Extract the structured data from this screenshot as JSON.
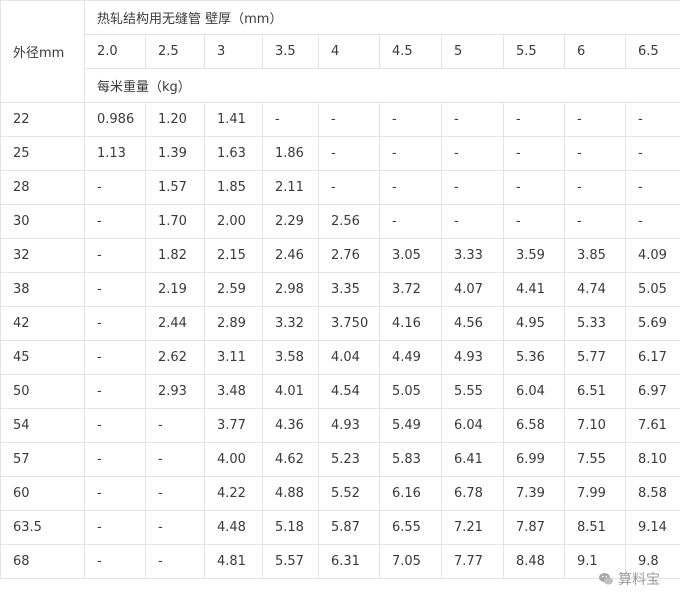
{
  "table": {
    "od_label": "外径mm",
    "title": "热轧结构用无缝管 壁厚（mm）",
    "unit_row": "每米重量（kg）",
    "thicknesses": [
      "2.0",
      "2.5",
      "3",
      "3.5",
      "4",
      "4.5",
      "5",
      "5.5",
      "6",
      "6.5"
    ],
    "rows": [
      {
        "od": "22",
        "values": [
          "0.986",
          "1.20",
          "1.41",
          "-",
          "-",
          "-",
          "-",
          "-",
          "-",
          "-"
        ]
      },
      {
        "od": "25",
        "values": [
          "1.13",
          "1.39",
          "1.63",
          "1.86",
          "-",
          "-",
          "-",
          "-",
          "-",
          "-"
        ]
      },
      {
        "od": "28",
        "values": [
          "-",
          "1.57",
          "1.85",
          "2.11",
          "-",
          "-",
          "-",
          "-",
          "-",
          "-"
        ]
      },
      {
        "od": "30",
        "values": [
          "-",
          "1.70",
          "2.00",
          "2.29",
          "2.56",
          "-",
          "-",
          "-",
          "-",
          "-"
        ]
      },
      {
        "od": "32",
        "values": [
          "-",
          "1.82",
          "2.15",
          "2.46",
          "2.76",
          "3.05",
          "3.33",
          "3.59",
          "3.85",
          "4.09"
        ]
      },
      {
        "od": "38",
        "values": [
          "-",
          "2.19",
          "2.59",
          "2.98",
          "3.35",
          "3.72",
          "4.07",
          "4.41",
          "4.74",
          "5.05"
        ]
      },
      {
        "od": "42",
        "values": [
          "-",
          "2.44",
          "2.89",
          "3.32",
          "3.750",
          "4.16",
          "4.56",
          "4.95",
          "5.33",
          "5.69"
        ]
      },
      {
        "od": "45",
        "values": [
          "-",
          "2.62",
          "3.11",
          "3.58",
          "4.04",
          "4.49",
          "4.93",
          "5.36",
          "5.77",
          "6.17"
        ]
      },
      {
        "od": "50",
        "values": [
          "-",
          "2.93",
          "3.48",
          "4.01",
          "4.54",
          "5.05",
          "5.55",
          "6.04",
          "6.51",
          "6.97"
        ]
      },
      {
        "od": "54",
        "values": [
          "-",
          "-",
          "3.77",
          "4.36",
          "4.93",
          "5.49",
          "6.04",
          "6.58",
          "7.10",
          "7.61"
        ]
      },
      {
        "od": "57",
        "values": [
          "-",
          "-",
          "4.00",
          "4.62",
          "5.23",
          "5.83",
          "6.41",
          "6.99",
          "7.55",
          "8.10"
        ]
      },
      {
        "od": "60",
        "values": [
          "-",
          "-",
          "4.22",
          "4.88",
          "5.52",
          "6.16",
          "6.78",
          "7.39",
          "7.99",
          "8.58"
        ]
      },
      {
        "od": "63.5",
        "values": [
          "-",
          "-",
          "4.48",
          "5.18",
          "5.87",
          "6.55",
          "7.21",
          "7.87",
          "8.51",
          "9.14"
        ]
      },
      {
        "od": "68",
        "values": [
          "-",
          "-",
          "4.81",
          "5.57",
          "6.31",
          "7.05",
          "7.77",
          "8.48",
          "9.1",
          "9.8"
        ]
      }
    ]
  },
  "watermark": {
    "text": "算料宝",
    "icon": "wechat-icon"
  }
}
